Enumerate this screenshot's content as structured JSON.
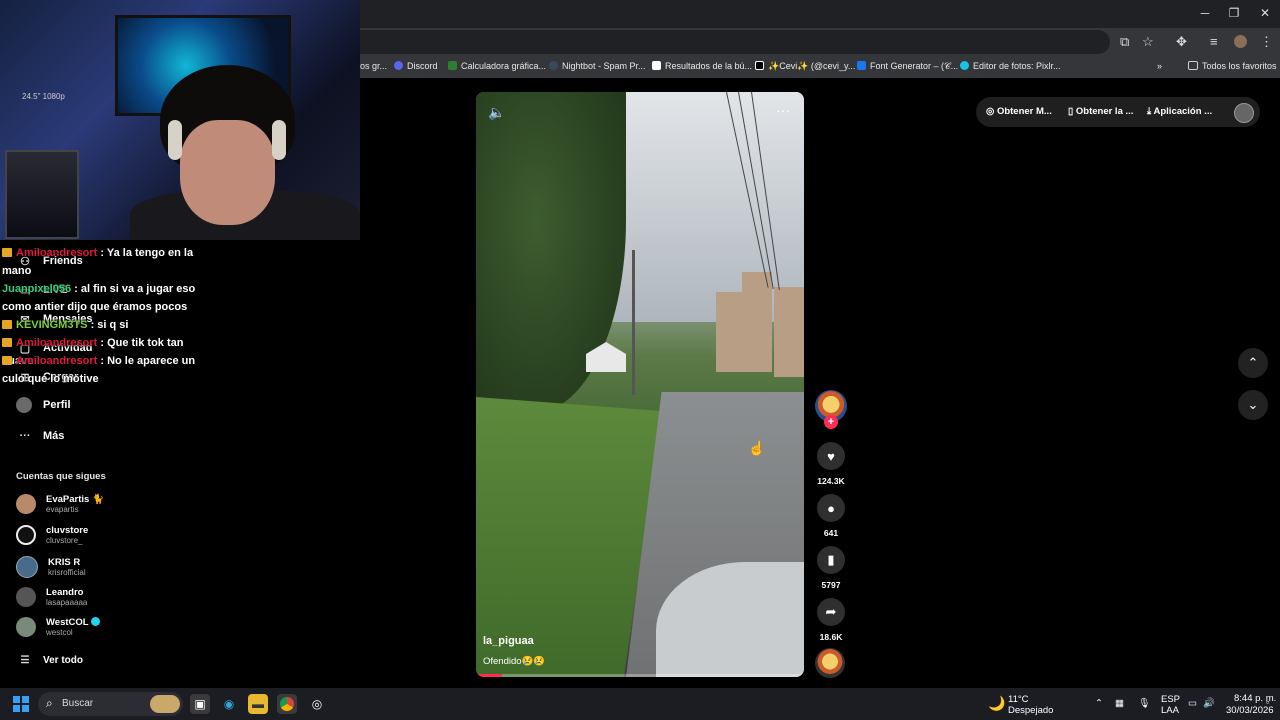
{
  "browser": {
    "window_controls": {
      "minimize": "─",
      "maximize": "❐",
      "close": "✕"
    },
    "bookmarks": [
      {
        "label": "os gr...",
        "color": "#888888"
      },
      {
        "label": "Discord",
        "color": "#5865f2"
      },
      {
        "label": "Calculadora gráfica...",
        "color": "#2e7d32"
      },
      {
        "label": "Nightbot - Spam Pr...",
        "color": "#3a4a5c"
      },
      {
        "label": "Resultados de la bú...",
        "color": "#ffffff"
      },
      {
        "label": "✨Cevi✨ (@cevi_y...",
        "color": "#000000"
      },
      {
        "label": "Font Generator – (𝒞...",
        "color": "#1877f2"
      },
      {
        "label": "Editor de fotos: Pixlr...",
        "color": "#19c3e8"
      }
    ],
    "all_bookmarks": "Todos los favoritos"
  },
  "stream": {
    "cam_text": "24.5\" 1080p",
    "chat": [
      {
        "user": "Amiloandresort",
        "user_color": "#e0173b",
        "badge": true,
        "message": " : Ya la tengo en la mano"
      },
      {
        "user": "Juanpixel056",
        "user_color": "#35d17a",
        "badge": false,
        "message": " : al fin si va a jugar eso como antier dijo que éramos pocos"
      },
      {
        "user": "KEVINGM3TS",
        "user_color": "#7cd23a",
        "badge": true,
        "message": " : si q si"
      },
      {
        "user": "Amiloandresort",
        "user_color": "#e0173b",
        "badge": true,
        "message": " : Que tik tok tan suave"
      },
      {
        "user": "Amiloandresort",
        "user_color": "#e0173b",
        "badge": true,
        "message": " : No le aparece un culo que lo motive"
      }
    ]
  },
  "sidebar": {
    "nav": [
      {
        "label": "Friends",
        "icon": "friends-icon"
      },
      {
        "label": "LIVE",
        "icon": "live-icon"
      },
      {
        "label": "Mensajes",
        "icon": "messages-icon"
      },
      {
        "label": "Actividad",
        "icon": "activity-icon"
      },
      {
        "label": "Cargar",
        "icon": "upload-icon"
      },
      {
        "label": "Perfil",
        "icon": "profile-icon"
      },
      {
        "label": "Más",
        "icon": "more-icon"
      }
    ],
    "messages_badge": "9",
    "following_title": "Cuentas que sigues",
    "accounts": [
      {
        "name": "EvaPartis 🐈",
        "handle": "evapartis",
        "color": "#b88a6a"
      },
      {
        "name": "cluvstore",
        "handle": "cluvstore_",
        "color": "#eeeeee"
      },
      {
        "name": "KRIS R",
        "handle": "krisrofficial",
        "color": "#4a6a8a"
      },
      {
        "name": "Leandro",
        "handle": "lasapaaaaa",
        "color": "#555555"
      },
      {
        "name": "WestCOL",
        "handle": "westcol",
        "color": "#7a8a7a",
        "verified": true
      }
    ],
    "see_all": "Ver todo"
  },
  "video": {
    "username": "la_piguaa",
    "caption": "Ofendido😢😢",
    "progress": 0.08
  },
  "actions": {
    "likes": "124.3K",
    "comments": "641",
    "saves": "5797",
    "shares": "18.6K"
  },
  "topbar": {
    "coins": "Obtener M...",
    "app": "Obtener la ...",
    "download": "Aplicación ..."
  },
  "taskbar": {
    "search": "Buscar",
    "weather_temp": "11°C",
    "weather_desc": "Despejado",
    "lang": "ESP",
    "lang_sub": "LAA",
    "time": "8:44 p. m.",
    "date": "30/03/2026"
  }
}
